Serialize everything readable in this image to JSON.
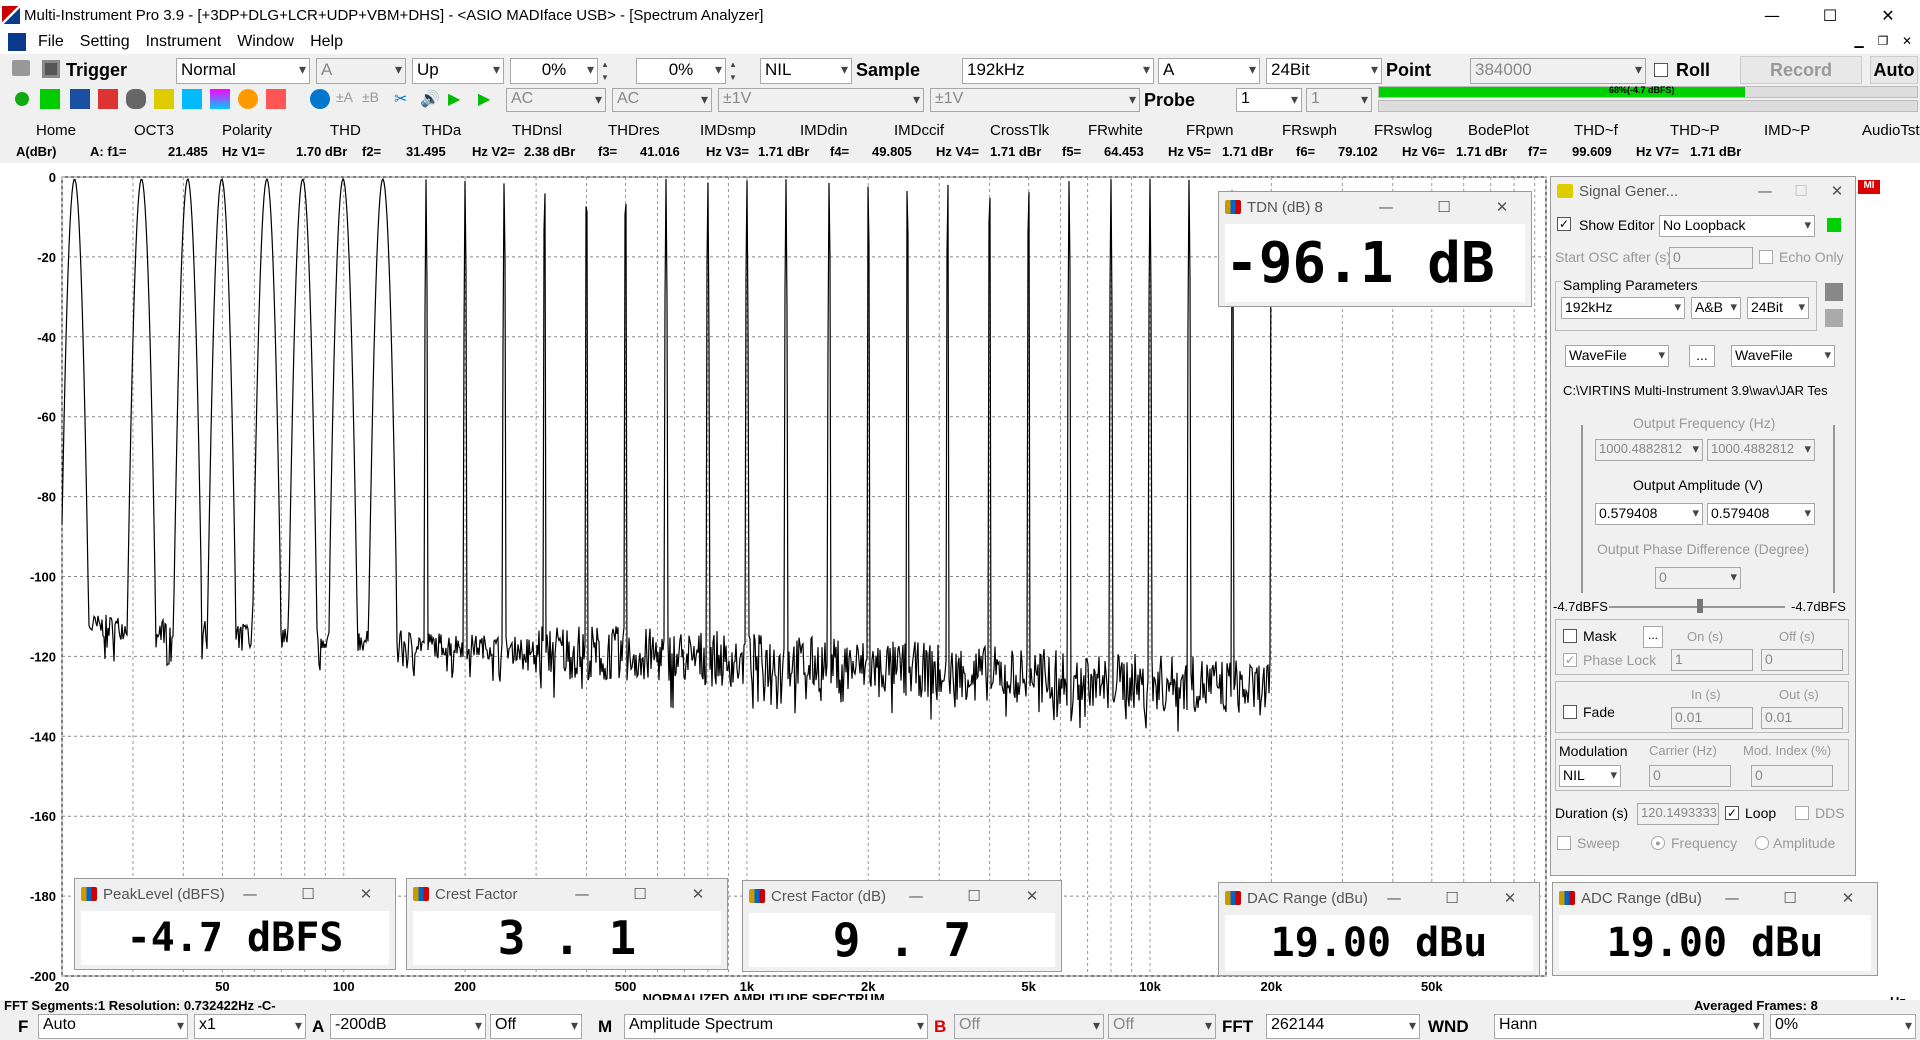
{
  "window": {
    "title": "Multi-Instrument Pro 3.9    -    [+3DP+DLG+LCR+UDP+VBM+DHS]    -    <ASIO MADIface USB> - [Spectrum Analyzer]",
    "min": "—",
    "max": "☐",
    "close": "✕"
  },
  "menu": {
    "file": "File",
    "setting": "Setting",
    "instrument": "Instrument",
    "window": "Window",
    "help": "Help"
  },
  "toolbar1": {
    "trigger": "Trigger",
    "mode": "Normal",
    "channel": "A",
    "edge": "Up",
    "level": "0%",
    "delay": "0%",
    "nil": "NIL",
    "sample_label": "Sample",
    "sample_rate": "192kHz",
    "sample_channel": "A",
    "bits": "24Bit",
    "point_label": "Point",
    "points": "384000",
    "roll": "Roll",
    "record": "Record",
    "auto": "Auto"
  },
  "toolbar2": {
    "coupling_a": "AC",
    "coupling_b": "AC",
    "range_a": "±1V",
    "range_b": "±1V",
    "probe_label": "Probe",
    "probe_a": "1",
    "probe_b": "1",
    "level_text": "68%(-4.7 dBFS)",
    "level_fill": 0.68
  },
  "tabs": [
    "Home",
    "OCT3",
    "Polarity",
    "THD",
    "THDa",
    "THDnsl",
    "THDres",
    "IMDsmp",
    "IMDdin",
    "IMDccif",
    "CrossTlk",
    "FRwhite",
    "FRpwn",
    "FRswph",
    "FRswlog",
    "BodePlot",
    "THD~f",
    "THD~P",
    "IMD~P",
    "AudioTst"
  ],
  "readout": [
    "A(dBr)",
    "A:  f1=",
    "21.485",
    "Hz  V1=",
    "1.70 dBr",
    "f2=",
    "31.495",
    "Hz  V2=",
    "2.38 dBr",
    "f3=",
    "41.016",
    "Hz  V3=",
    "1.71 dBr",
    "f4=",
    "49.805",
    "Hz  V4=",
    "1.71 dBr",
    "f5=",
    "64.453",
    "Hz  V5=",
    "1.71 dBr",
    "f6=",
    "79.102",
    "Hz  V6=",
    "1.71 dBr",
    "f7=",
    "99.609",
    "Hz  V7=",
    "1.71 dBr"
  ],
  "chart_data": {
    "type": "line",
    "title": "NORMALIZED AMPLITUDE  SPECTRUM",
    "xlabel": "Hz",
    "ylabel": "",
    "xscale": "log",
    "xlim": [
      20,
      96000
    ],
    "ylim": [
      -200,
      0
    ],
    "yticks": [
      0,
      -20,
      -40,
      -60,
      -80,
      -100,
      -120,
      -140,
      -160,
      -180,
      -200
    ],
    "xticks": [
      {
        "v": 20,
        "l": "20"
      },
      {
        "v": 50,
        "l": "50"
      },
      {
        "v": 100,
        "l": "100"
      },
      {
        "v": 200,
        "l": "200"
      },
      {
        "v": 500,
        "l": "500"
      },
      {
        "v": 1000,
        "l": "1k"
      },
      {
        "v": 2000,
        "l": "2k"
      },
      {
        "v": 5000,
        "l": "5k"
      },
      {
        "v": 10000,
        "l": "10k"
      },
      {
        "v": 20000,
        "l": "20k"
      },
      {
        "v": 50000,
        "l": "50k"
      }
    ],
    "tone_frequencies": [
      21.485,
      31.495,
      41.016,
      49.805,
      64.453,
      79.102,
      99.609,
      125,
      160,
      200,
      250,
      315,
      400,
      500,
      630,
      800,
      1000,
      1250,
      1600,
      2000,
      2500,
      3150,
      4000,
      5000,
      6300,
      8000,
      10000,
      12500,
      16000,
      20000
    ],
    "noise_floor": {
      "low_hz": -112,
      "high_hz": -128
    }
  },
  "status": {
    "left": "FFT Segments:1   Resolution: 0.732422Hz  -C-",
    "right": "Averaged Frames: 8"
  },
  "panels": {
    "tdn": {
      "title": "TDN (dB)  8",
      "value": "-96.1 dB"
    },
    "peak": {
      "title": "PeakLevel (dBFS)",
      "value": "-4.7 dBFS"
    },
    "crest": {
      "title": "Crest Factor",
      "value": "3 . 1"
    },
    "crestdb": {
      "title": "Crest Factor (dB)",
      "value": "9 . 7"
    },
    "dac": {
      "title": "DAC Range (dBu)",
      "value": "19.00 dBu"
    },
    "adc": {
      "title": "ADC Range (dBu)",
      "value": "19.00 dBu"
    }
  },
  "siggen": {
    "title": "Signal Gener...",
    "show_editor": "Show Editor",
    "loopback": "No Loopback",
    "start_osc": "Start OSC after (s)",
    "start_osc_val": "0",
    "echo_only": "Echo Only",
    "sampling": "Sampling Parameters",
    "rate": "192kHz",
    "ch": "A&B",
    "bits": "24Bit",
    "wave_a": "WaveFile",
    "browse": "...",
    "wave_b": "WaveFile",
    "path": "C:\\VIRTINS Multi-Instrument 3.9\\wav\\JAR Tes",
    "out_freq": "Output Frequency (Hz)",
    "freq_a": "1000.4882812",
    "freq_b": "1000.4882812",
    "out_amp": "Output Amplitude (V)",
    "amp_a": "0.579408",
    "amp_b": "0.579408",
    "phase": "Output Phase Difference (Degree)",
    "phase_val": "0",
    "dbfs_l": "-4.7dBFS",
    "dbfs_r": "-4.7dBFS",
    "mask": "Mask",
    "mask_btn": "...",
    "on_s": "On (s)",
    "off_s": "Off (s)",
    "phase_lock": "Phase Lock",
    "on_val": "1",
    "off_val": "0",
    "fade": "Fade",
    "in_s": "In (s)",
    "out_s": "Out (s)",
    "in_val": "0.01",
    "out_val": "0.01",
    "modulation": "Modulation",
    "carrier": "Carrier (Hz)",
    "mod_index": "Mod. Index (%)",
    "mod_val": "NIL",
    "carrier_val": "0",
    "index_val": "0",
    "duration": "Duration (s)",
    "duration_val": "120.1493333",
    "loop": "Loop",
    "dds": "DDS",
    "sweep": "Sweep",
    "frequency": "Frequency",
    "amplitude": "Amplitude"
  },
  "bottom": {
    "f": "F",
    "f_val": "Auto",
    "mult": "x1",
    "a": "A",
    "a_range": "-200dB",
    "a_off": "Off",
    "m": "M",
    "m_val": "Amplitude Spectrum",
    "b": "B",
    "b_val": "Off",
    "b_off": "Off",
    "fft": "FFT",
    "fft_val": "262144",
    "wnd": "WND",
    "wnd_val": "Hann",
    "pct": "0%"
  },
  "colors": {
    "accent_green": "#00d000",
    "red_label": "#d00000",
    "trace": "#000000"
  }
}
